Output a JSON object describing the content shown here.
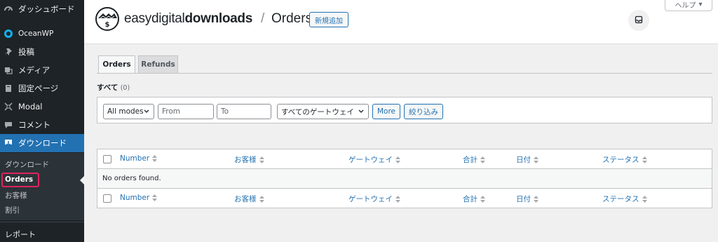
{
  "sidebar": {
    "items": [
      {
        "label": "ダッシュボード",
        "icon": "dashboard-icon"
      },
      {
        "label": "OceanWP",
        "icon": "oceanwp-icon"
      },
      {
        "label": "投稿",
        "icon": "pin-icon"
      },
      {
        "label": "メディア",
        "icon": "media-icon"
      },
      {
        "label": "固定ページ",
        "icon": "page-icon"
      },
      {
        "label": "Modal",
        "icon": "modal-icon"
      },
      {
        "label": "コメント",
        "icon": "comment-icon"
      },
      {
        "label": "ダウンロード",
        "icon": "download-icon"
      }
    ],
    "submenu": [
      "ダウンロード",
      "Orders",
      "お客様",
      "割引"
    ],
    "reports": "レポート"
  },
  "header": {
    "brand_light": "easy",
    "brand_mid": "digital",
    "brand_bold": "downloads",
    "separator": "/",
    "title": "Orders",
    "add_new": "新規追加",
    "help": "ヘルプ"
  },
  "tabs": [
    "Orders",
    "Refunds"
  ],
  "views": {
    "all_label": "すべて",
    "all_count": "(0)"
  },
  "filters": {
    "mode": "All modes",
    "from_placeholder": "From",
    "to_placeholder": "To",
    "gateway": "すべてのゲートウェイ",
    "more": "More",
    "filter_button": "絞り込み"
  },
  "table": {
    "columns": [
      "Number",
      "お客様",
      "ゲートウェイ",
      "合計",
      "日付",
      "ステータス"
    ],
    "empty_message": "No orders found."
  },
  "colors": {
    "accent": "#2271b1",
    "sidebar": "#1d2327",
    "active": "#2271b1",
    "highlight": "#e0245e"
  }
}
